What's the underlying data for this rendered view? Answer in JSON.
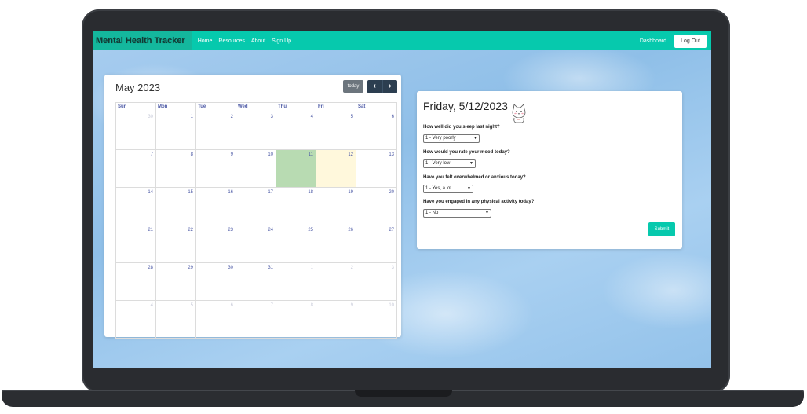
{
  "navbar": {
    "brand": "Mental Health Tracker",
    "links": [
      "Home",
      "Resources",
      "About",
      "Sign Up"
    ],
    "dashboard": "Dashboard",
    "logout": "Log Out",
    "accent_color": "#06c9ad"
  },
  "calendar": {
    "title": "May 2023",
    "today_label": "today",
    "prev_icon": "chevron-left-icon",
    "next_icon": "chevron-right-icon",
    "weekdays": [
      "Sun",
      "Mon",
      "Tue",
      "Wed",
      "Thu",
      "Fri",
      "Sat"
    ],
    "weeks": [
      [
        "30",
        "1",
        "2",
        "3",
        "4",
        "5",
        "6"
      ],
      [
        "7",
        "8",
        "9",
        "10",
        "11",
        "12",
        "13"
      ],
      [
        "14",
        "15",
        "16",
        "17",
        "18",
        "19",
        "20"
      ],
      [
        "21",
        "22",
        "23",
        "24",
        "25",
        "26",
        "27"
      ],
      [
        "28",
        "29",
        "30",
        "31",
        "1",
        "2",
        "3"
      ],
      [
        "4",
        "5",
        "6",
        "7",
        "8",
        "9",
        "10"
      ]
    ],
    "selected_day": "11",
    "today_day": "12",
    "selected_color": "#b8dbb2",
    "today_color": "#fff8dc"
  },
  "form": {
    "title": "Friday, 5/12/2023",
    "icon": "cat-icon",
    "questions": [
      {
        "label": "How well did you sleep last night?",
        "value": "1 - Very poorly"
      },
      {
        "label": "How would you rate your mood today?",
        "value": "1 - Very low"
      },
      {
        "label": "Have you felt overwhelmed or anxious today?",
        "value": "1 - Yes, a lot"
      },
      {
        "label": "Have you engaged in any physical activity today?",
        "value": "1 - No"
      }
    ],
    "submit": "Submit"
  }
}
